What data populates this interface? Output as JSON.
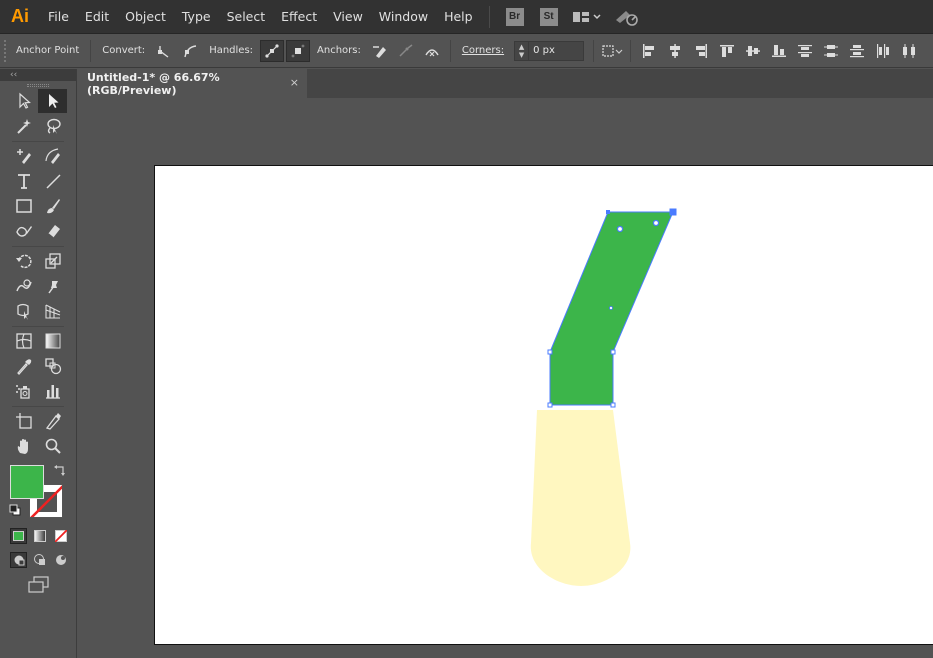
{
  "app": {
    "logo": "Ai",
    "name": "Adobe Illustrator"
  },
  "menu": {
    "items": [
      "File",
      "Edit",
      "Object",
      "Type",
      "Select",
      "Effect",
      "View",
      "Window",
      "Help"
    ],
    "bridge_badge": "Br",
    "stock_badge": "St"
  },
  "control_bar": {
    "mode_label": "Anchor Point",
    "convert_label": "Convert:",
    "handles_label": "Handles:",
    "anchors_label": "Anchors:",
    "corners_label": "Corners:",
    "corners_value": "0 px"
  },
  "toolbar": {
    "collapse_label": "‹‹"
  },
  "document_tab": {
    "title": "Untitled-1* @ 66.67% (RGB/Preview)",
    "close_glyph": "×"
  },
  "colors": {
    "fill": "#3cb54a",
    "stroke": "none",
    "selection": "#4a7bff",
    "flame": "#fff7c0"
  },
  "icons": [
    "selection-tool-icon",
    "direct-selection-tool-icon",
    "magic-wand-icon",
    "lasso-icon",
    "pen-tool-icon",
    "curvature-tool-icon",
    "type-tool-icon",
    "line-tool-icon",
    "rectangle-tool-icon",
    "paintbrush-tool-icon",
    "shaper-tool-icon",
    "eraser-tool-icon",
    "rotate-tool-icon",
    "scale-tool-icon",
    "warp-tool-icon",
    "puppet-warp-icon",
    "free-transform-icon",
    "perspective-grid-icon",
    "mesh-tool-icon",
    "gradient-tool-icon",
    "eyedropper-icon",
    "blend-tool-icon",
    "symbol-sprayer-icon",
    "column-graph-icon",
    "artboard-tool-icon",
    "slice-tool-icon",
    "hand-tool-icon",
    "zoom-tool-icon"
  ]
}
